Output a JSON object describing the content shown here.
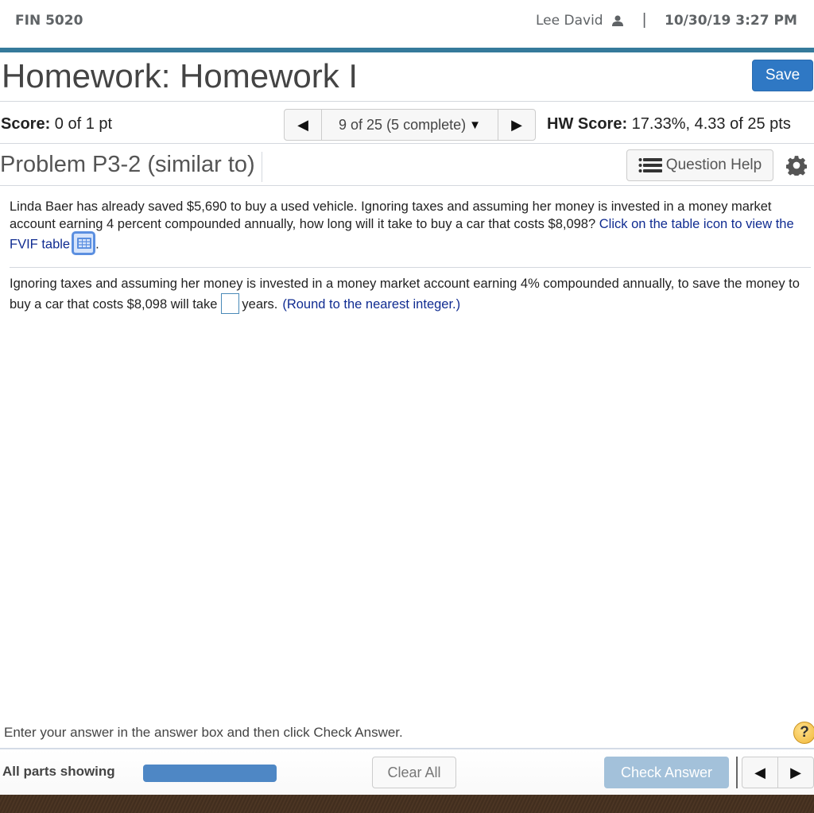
{
  "header": {
    "course": "FIN 5020",
    "user_name": "Lee David",
    "separator": "|",
    "datetime": "10/30/19 3:27 PM"
  },
  "title_row": {
    "title": "Homework: Homework I",
    "save_label": "Save"
  },
  "score_row": {
    "score_label": "Score:",
    "score_value": " 0 of 1 pt",
    "nav_prev": "◀",
    "nav_selector": "9 of 25 (5 complete)",
    "nav_caret": "▼",
    "nav_next": "▶",
    "hw_score_label": "HW Score:",
    "hw_score_value": " 17.33%, 4.33 of 25 pts"
  },
  "problem_row": {
    "title": "Problem P3-2 (similar to)",
    "question_help_label": "Question Help"
  },
  "question": {
    "text": "Linda Baer has already saved $5,690 to buy a used vehicle. Ignoring taxes and assuming her money is invested in a money market account earning 4 percent compounded annually, how long will it take to buy a car that costs $8,098? ",
    "link_text": "Click on the table icon to view the FVIF table",
    "trailing": "."
  },
  "answer": {
    "prefix": "Ignoring taxes and assuming her money is invested in a money market account earning 4% compounded annually, to save  the money to buy a car that costs $8,098 will take",
    "input_value": "",
    "suffix": "years.",
    "hint": "(Round to the nearest integer.)"
  },
  "footer": {
    "instruction": "Enter your answer in the answer box and then click Check Answer.",
    "help_symbol": "?",
    "parts_label": "All parts showing",
    "parts_progress": 1.0,
    "clear_all_label": "Clear All",
    "check_answer_label": "Check Answer",
    "prev_symbol": "◀",
    "next_symbol": "▶"
  },
  "colors": {
    "accent_bar": "#357a9b",
    "save_button": "#2f78c4",
    "link": "#102c91",
    "check_answer_disabled": "#a3c1da",
    "progress_fill": "#4e87c5"
  }
}
